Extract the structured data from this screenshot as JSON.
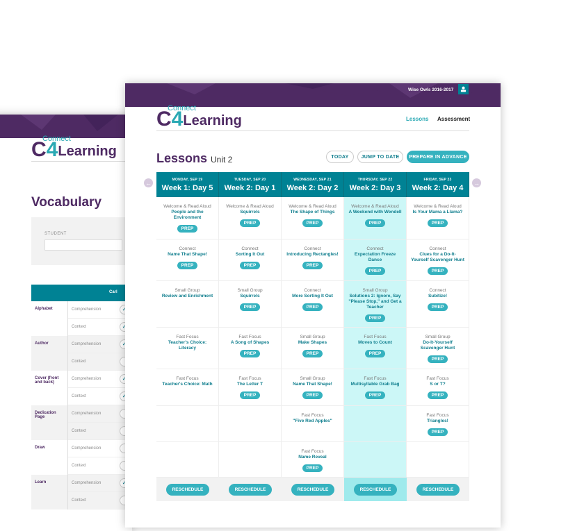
{
  "colors": {
    "brand_purple": "#4e2a63",
    "teal": "#008294",
    "accent": "#35b2bf",
    "highlight": "#ccf7f7"
  },
  "back": {
    "logo": {
      "top": "Connect",
      "main": "Learning",
      "digit": "4"
    },
    "title": "Vocabulary",
    "student_label": "STUDENT",
    "student_value": "",
    "table_header": "Carl",
    "words": [
      {
        "word": "Alphabet",
        "rows": [
          {
            "type": "Comprehension",
            "checked": true
          },
          {
            "type": "Context",
            "checked": true
          }
        ]
      },
      {
        "word": "Author",
        "rows": [
          {
            "type": "Comprehension",
            "checked": true
          },
          {
            "type": "Context",
            "checked": false
          }
        ]
      },
      {
        "word": "Cover (front and back)",
        "rows": [
          {
            "type": "Comprehension",
            "checked": true
          },
          {
            "type": "Context",
            "checked": true
          }
        ]
      },
      {
        "word": "Dedication Page",
        "rows": [
          {
            "type": "Comprehension",
            "checked": false
          },
          {
            "type": "Context",
            "checked": false
          }
        ]
      },
      {
        "word": "Draw",
        "rows": [
          {
            "type": "Comprehension",
            "checked": false
          },
          {
            "type": "Context",
            "checked": false
          }
        ]
      },
      {
        "word": "Learn",
        "rows": [
          {
            "type": "Comprehension",
            "checked": true
          },
          {
            "type": "Context",
            "checked": false
          }
        ]
      }
    ]
  },
  "front": {
    "class_name": "Wise Owls 2016-2017",
    "user_icon": "user-icon",
    "logo": {
      "top": "Connect",
      "main": "Learning",
      "digit": "4"
    },
    "nav": {
      "lessons": "Lessons",
      "assessment": "Assessment"
    },
    "title": "Lessons",
    "unit": "Unit 2",
    "buttons": {
      "today": "TODAY",
      "jump": "JUMP TO DATE",
      "prepare": "PREPARE IN ADVANCE"
    },
    "prep_label": "PREP",
    "reschedule_label": "RESCHEDULE",
    "highlighted_day": 3,
    "days": [
      {
        "date": "MONDAY, SEP 19",
        "label": "Week 1: Day 5",
        "items": [
          {
            "type": "Welcome & Read Aloud",
            "name": "People and the Environment",
            "prep": true
          },
          {
            "type": "Connect",
            "name": "Name That Shape!",
            "prep": true
          },
          {
            "type": "Small Group",
            "name": "Review and Enrichment",
            "prep": false
          },
          {
            "type": "Fast Focus",
            "name": "Teacher's Choice: Literacy",
            "prep": false
          },
          {
            "type": "Fast Focus",
            "name": "Teacher's Choice: Math",
            "prep": false
          },
          null,
          null
        ]
      },
      {
        "date": "TUESDAY, SEP 20",
        "label": "Week 2: Day 1",
        "items": [
          {
            "type": "Welcome & Read Aloud",
            "name": "Squirrels",
            "prep": true
          },
          {
            "type": "Connect",
            "name": "Sorting It Out",
            "prep": true
          },
          {
            "type": "Small Group",
            "name": "Squirrels",
            "prep": true
          },
          {
            "type": "Fast Focus",
            "name": "A Song of Shapes",
            "prep": true
          },
          {
            "type": "Fast Focus",
            "name": "The Letter T",
            "prep": true
          },
          null,
          null
        ]
      },
      {
        "date": "WEDNESDAY, SEP 21",
        "label": "Week 2: Day 2",
        "items": [
          {
            "type": "Welcome & Read Aloud",
            "name": "The Shape of Things",
            "prep": true
          },
          {
            "type": "Connect",
            "name": "Introducing Rectangles!",
            "prep": true
          },
          {
            "type": "Connect",
            "name": "More Sorting It Out",
            "prep": true
          },
          {
            "type": "Small Group",
            "name": "Make Shapes",
            "prep": true
          },
          {
            "type": "Small Group",
            "name": "Name That Shape!",
            "prep": true
          },
          {
            "type": "Fast Focus",
            "name": "\"Five Red Apples\"",
            "prep": false
          },
          {
            "type": "Fast Focus",
            "name": "Name Reveal",
            "prep": true
          }
        ]
      },
      {
        "date": "THURSDAY, SEP 22",
        "label": "Week 2: Day 3",
        "items": [
          {
            "type": "Welcome & Read Aloud",
            "name": "A Weekend with Wendell",
            "prep": true
          },
          {
            "type": "Connect",
            "name": "Expectation Freeze Dance",
            "prep": true
          },
          {
            "type": "Small Group",
            "name": "Solutions 2: Ignore, Say \"Please Stop,\" and Get a Teacher",
            "prep": true
          },
          {
            "type": "Fast Focus",
            "name": "Moves to Count",
            "prep": true
          },
          {
            "type": "Fast Focus",
            "name": "Multisyllable Grab Bag",
            "prep": true
          },
          null,
          null
        ]
      },
      {
        "date": "FRIDAY, SEP 23",
        "label": "Week 2: Day 4",
        "items": [
          {
            "type": "Welcome & Read Aloud",
            "name": "Is Your Mama a Llama?",
            "prep": true
          },
          {
            "type": "Connect",
            "name": "Clues for a Do-It-Yourself Scavenger Hunt",
            "prep": true
          },
          {
            "type": "Connect",
            "name": "Subitize!",
            "prep": true
          },
          {
            "type": "Small Group",
            "name": "Do-It-Yourself Scavenger Hunt",
            "prep": true
          },
          {
            "type": "Fast Focus",
            "name": "S or T?",
            "prep": true
          },
          {
            "type": "Fast Focus",
            "name": "Triangles!",
            "prep": true
          },
          null
        ]
      }
    ]
  }
}
